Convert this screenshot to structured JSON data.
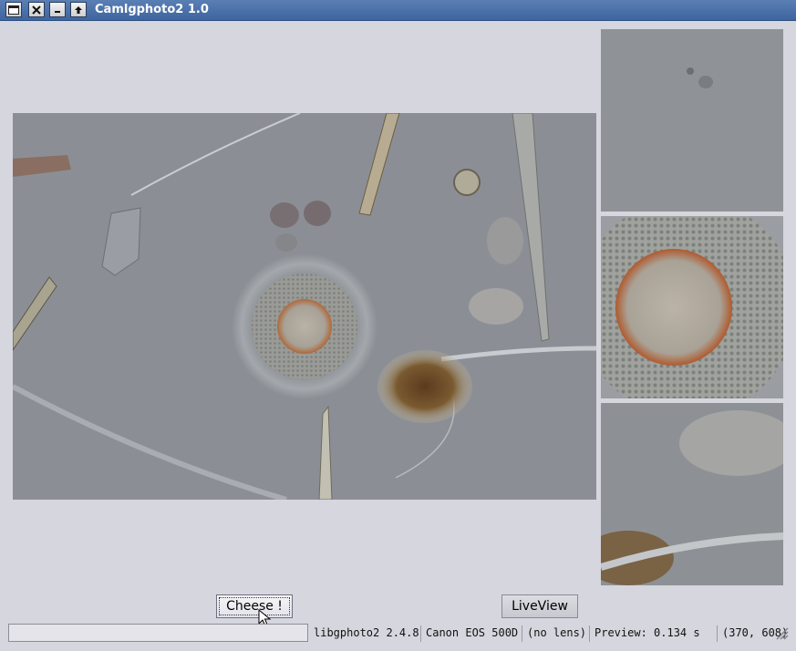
{
  "window": {
    "title": "Camlgphoto2 1.0"
  },
  "titlebar": {
    "menu_icon": "window-menu-icon",
    "close_icon": "close-icon",
    "minimize_icon": "minimize-icon",
    "maximize_icon": "maximize-icon"
  },
  "controls": {
    "cheese_label": "Cheese !",
    "liveview_label": "LiveView"
  },
  "statusbar": {
    "progress": 0,
    "library": "libgphoto2 2.4.8",
    "camera": "Canon EOS 500D",
    "lens": "(no lens)",
    "preview": "Preview: 0.134 s",
    "coords": "(370, 608)"
  },
  "colors": {
    "titlebar": "#4a70a8",
    "window_bg": "#d6d6de",
    "photo_bg": "#8a8e94"
  }
}
